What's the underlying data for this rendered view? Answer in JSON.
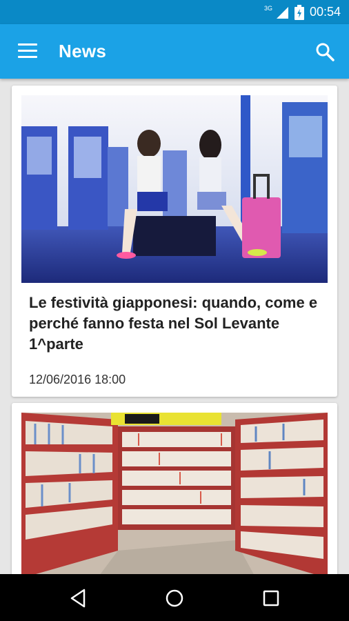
{
  "status_bar": {
    "network": "3G",
    "time": "00:54"
  },
  "app_bar": {
    "title": "News"
  },
  "articles": [
    {
      "title": "Le festività giapponesi: quando, come e perché fanno festa nel Sol Levante 1^parte",
      "date": "12/06/2016 18:00"
    },
    {
      "title": "",
      "date": ""
    }
  ],
  "colors": {
    "app_bar": "#1ba2e6",
    "status_bar": "#0a89c6",
    "background": "#e6e6e6"
  },
  "icons": [
    "signal-icon",
    "battery-icon",
    "menu-icon",
    "search-icon",
    "back-icon",
    "home-icon",
    "recents-icon"
  ]
}
